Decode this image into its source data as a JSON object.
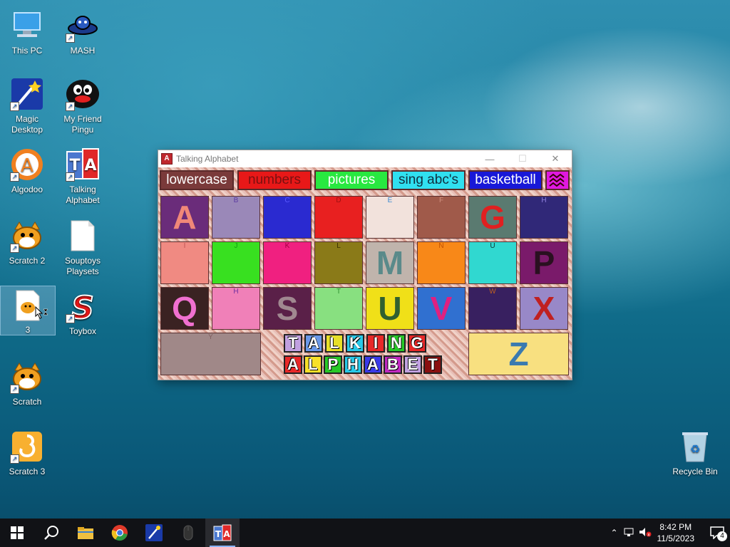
{
  "desktop": {
    "icons": [
      {
        "label": "This PC"
      },
      {
        "label": "MASH"
      },
      {
        "label": "Magic Desktop"
      },
      {
        "label": "My Friend Pingu"
      },
      {
        "label": "Algodoo"
      },
      {
        "label": "Talking Alphabet"
      },
      {
        "label": "Scratch 2"
      },
      {
        "label": "Souptoys Playsets"
      },
      {
        "label": "3"
      },
      {
        "label": "Toybox"
      },
      {
        "label": "Scratch"
      },
      {
        "label": "Scratch 3"
      },
      {
        "label": "Recycle Bin"
      }
    ]
  },
  "window": {
    "title": "Talking Alphabet",
    "app_icon": "A",
    "toolbar": {
      "lowercase": "lowercase",
      "numbers": "numbers",
      "pictures": "pictures",
      "sing": "sing abc's",
      "basketball": "basketball",
      "zigzag_icon": "zigzag-icon"
    },
    "tiles": [
      {
        "small": "",
        "big": "A",
        "bg": "#6a2c7a",
        "fg": "#f08878"
      },
      {
        "small": "B",
        "big": "",
        "bg": "#9a88b8",
        "fg": "#5a3aa0"
      },
      {
        "small": "C",
        "big": "",
        "bg": "#2a2ad0",
        "fg": "#5a5aff"
      },
      {
        "small": "D",
        "big": "",
        "bg": "#e82020",
        "fg": "#a01010"
      },
      {
        "small": "E",
        "big": "",
        "bg": "#f2e2dc",
        "fg": "#3a8ad0"
      },
      {
        "small": "F",
        "big": "",
        "bg": "#a05a4a",
        "fg": "#d09080"
      },
      {
        "small": "",
        "big": "G",
        "bg": "#5a7a70",
        "fg": "#e02020"
      },
      {
        "small": "H",
        "big": "",
        "bg": "#302878",
        "fg": "#9080e0"
      },
      {
        "small": "I",
        "big": "",
        "bg": "#f08a82",
        "fg": "#c05050"
      },
      {
        "small": "J",
        "big": "",
        "bg": "#38e020",
        "fg": "#10a010"
      },
      {
        "small": "K",
        "big": "",
        "bg": "#f02080",
        "fg": "#a00040"
      },
      {
        "small": "L",
        "big": "",
        "bg": "#8a7a18",
        "fg": "#3a3000"
      },
      {
        "small": "",
        "big": "M",
        "bg": "#c0b4ac",
        "fg": "#5a8a8a"
      },
      {
        "small": "N",
        "big": "",
        "bg": "#f88818",
        "fg": "#c05000"
      },
      {
        "small": "U",
        "big": "",
        "bg": "#30d8d0",
        "fg": "#103030"
      },
      {
        "small": "",
        "big": "P",
        "bg": "#7a1a6a",
        "fg": "#2a1020"
      },
      {
        "small": "",
        "big": "Q",
        "bg": "#3a2222",
        "fg": "#f070d0"
      },
      {
        "small": "H",
        "big": "",
        "bg": "#f080b8",
        "fg": "#7030a0"
      },
      {
        "small": "",
        "big": "S",
        "bg": "#5a2048",
        "fg": "#a08890"
      },
      {
        "small": "T",
        "big": "",
        "bg": "#88e080",
        "fg": "#309030"
      },
      {
        "small": "",
        "big": "U",
        "bg": "#f0e018",
        "fg": "#306030"
      },
      {
        "small": "",
        "big": "V",
        "bg": "#3070d0",
        "fg": "#e02080"
      },
      {
        "small": "W",
        "big": "",
        "bg": "#382060",
        "fg": "#c06020"
      },
      {
        "small": "",
        "big": "X",
        "bg": "#9888c8",
        "fg": "#c02020"
      },
      {
        "small": "Y",
        "big": "",
        "bg": "#a08888",
        "fg": "#806060"
      },
      {
        "small": "",
        "big": "Z",
        "bg": "#f8e080",
        "fg": "#3a7ab0"
      }
    ],
    "logo_row1": [
      "T",
      "A",
      "L",
      "K",
      "I",
      "N",
      "G"
    ],
    "logo_row2": [
      "A",
      "L",
      "P",
      "H",
      "A",
      "B",
      "E",
      "T"
    ]
  },
  "taskbar": {
    "time": "8:42 PM",
    "date": "11/5/2023",
    "notification_count": "4"
  }
}
